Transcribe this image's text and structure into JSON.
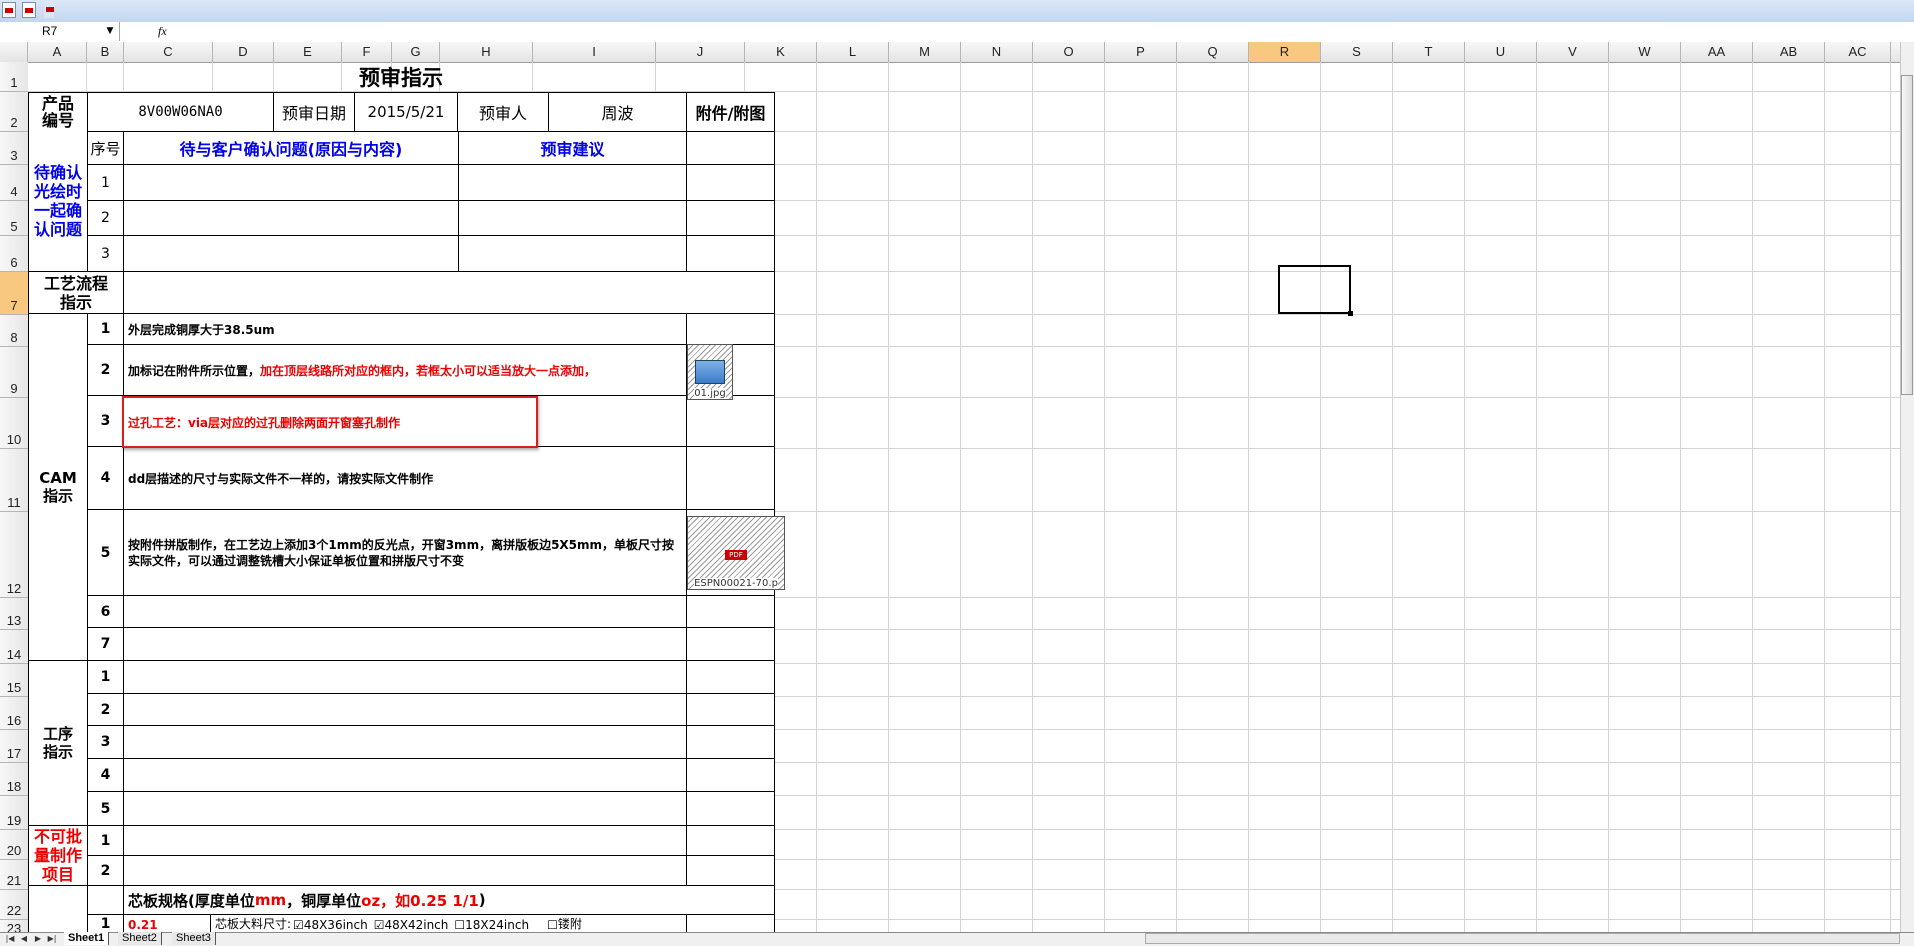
{
  "toolbar": {
    "icons": [
      "pdf-icon",
      "pdf-export-icon",
      "dropdown-icon"
    ]
  },
  "formula_bar": {
    "cell_ref": "R7",
    "fx": "fx",
    "content": ""
  },
  "columns": [
    "A",
    "B",
    "C",
    "D",
    "E",
    "F",
    "G",
    "H",
    "I",
    "J",
    "K",
    "L",
    "M",
    "N",
    "O",
    "P",
    "Q",
    "R",
    "S",
    "T",
    "U",
    "V",
    "W",
    "AA",
    "AB",
    "AC"
  ],
  "selected_column": "R",
  "rows": [
    "1",
    "2",
    "3",
    "4",
    "5",
    "6",
    "7",
    "8",
    "9",
    "10",
    "11",
    "12",
    "13",
    "14",
    "15",
    "16",
    "17",
    "18",
    "19",
    "20",
    "21",
    "22",
    "23"
  ],
  "selected_row": "7",
  "form": {
    "title": "预审指示",
    "header": {
      "product_label": "产品编号",
      "product_value": "8V00W06NA0",
      "date_label": "预审日期",
      "date_value": "2015/5/21",
      "reviewer_label": "预审人",
      "reviewer_value": "周波",
      "attach_label": "附件/附图"
    },
    "confirm": {
      "section_label": "待确认光绘时一起确认问题",
      "seq_header": "序号",
      "issue_header": "待与客户确认问题(原因与内容)",
      "advice_header": "预审建议",
      "rows": [
        "1",
        "2",
        "3"
      ]
    },
    "process_flow_label": "工艺流程指示",
    "cam": {
      "section_label": "CAM指示",
      "rows": [
        {
          "no": "1",
          "text": "外层完成铜厚大于38.5um",
          "text_red": ""
        },
        {
          "no": "2",
          "text": "加标记在附件所示位置，",
          "text_red": "加在顶层线路所对应的框内，若框太小可以适当放大一点添加，"
        },
        {
          "no": "3",
          "text": "",
          "text_red": "过孔工艺：via层对应的过孔删除两面开窗塞孔制作"
        },
        {
          "no": "4",
          "text": "dd层描述的尺寸与实际文件不一样的，请按实际文件制作",
          "text_red": ""
        },
        {
          "no": "5",
          "text": "按附件拼版制作，在工艺边上添加3个1mm的反光点，开窗3mm，离拼版板边5X5mm，单板尺寸按实际文件，可以通过调整铣槽大小保证单板位置和拼版尺寸不变",
          "text_red": ""
        },
        {
          "no": "6",
          "text": "",
          "text_red": ""
        },
        {
          "no": "7",
          "text": "",
          "text_red": ""
        }
      ],
      "attachments": [
        {
          "row": "2",
          "name": "01.jpg"
        },
        {
          "row": "5",
          "name": "ESPN00021-70.p"
        }
      ]
    },
    "process": {
      "section_label": "工序指示",
      "rows": [
        "1",
        "2",
        "3",
        "4",
        "5"
      ]
    },
    "not_batch": {
      "section_label": "不可批量制作项目",
      "rows": [
        "1",
        "2"
      ]
    },
    "core_spec": {
      "prefix": "芯板规格(厚度单位",
      "unit1": "mm",
      "middle": "，铜厚单位",
      "unit2": "oz，如0.25 1/1",
      "suffix": ")"
    },
    "row23": {
      "no": "1",
      "value_red": "0.21",
      "size_label": "芯板大料尺寸:",
      "options": [
        {
          "label": "48X36inch",
          "checked": true
        },
        {
          "label": "48X42inch",
          "checked": true
        },
        {
          "label": "18X24inch",
          "checked": false
        }
      ],
      "extra_label": "镂附"
    }
  },
  "sheets": [
    "Sheet1",
    "Sheet2",
    "Sheet3"
  ],
  "active_sheet": "Sheet1"
}
